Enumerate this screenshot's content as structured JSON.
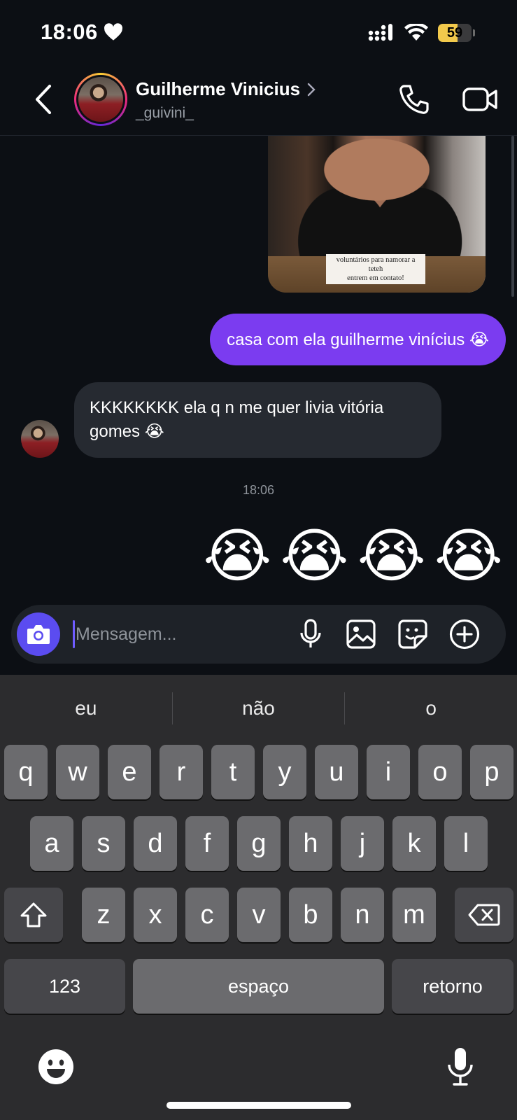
{
  "status_bar": {
    "time": "18:06",
    "battery": "59",
    "battery_level": 0.59
  },
  "header": {
    "contact_name": "Guilherme Vinicius",
    "username": "_guivini_"
  },
  "chat": {
    "image_caption_line1": "voluntários para namorar a teteh",
    "image_caption_line2": "entrem em contato!",
    "sent_message": "casa com ela guilherme vinícius 😭",
    "received_message": "KKKKKKKK ela q n me quer livia vitória gomes 😭",
    "timestamp": "18:06",
    "emojis": [
      "😭",
      "😭",
      "😭",
      "😭"
    ]
  },
  "composer": {
    "placeholder": "Mensagem..."
  },
  "keyboard": {
    "suggestions": [
      "eu",
      "não",
      "o"
    ],
    "row1": [
      "q",
      "w",
      "e",
      "r",
      "t",
      "y",
      "u",
      "i",
      "o",
      "p"
    ],
    "row2": [
      "a",
      "s",
      "d",
      "f",
      "g",
      "h",
      "j",
      "k",
      "l"
    ],
    "row3": [
      "z",
      "x",
      "c",
      "v",
      "b",
      "n",
      "m"
    ],
    "numbers_label": "123",
    "space_label": "espaço",
    "return_label": "retorno"
  },
  "icons": [
    "heart-icon",
    "signal-icon",
    "wifi-icon",
    "battery-icon",
    "back-icon",
    "chevron-right-icon",
    "phone-icon",
    "video-icon",
    "camera-icon",
    "microphone-icon",
    "gallery-icon",
    "sticker-icon",
    "plus-icon",
    "shift-icon",
    "delete-icon",
    "emoji-icon",
    "dictation-icon"
  ],
  "colors": {
    "background": "#0c0f14",
    "sent_bubble": "#7b3cf0",
    "received_bubble": "#262a31",
    "camera_button": "#5b4cf0",
    "keyboard_bg": "#2c2c2e",
    "key": "#6b6b6e"
  }
}
